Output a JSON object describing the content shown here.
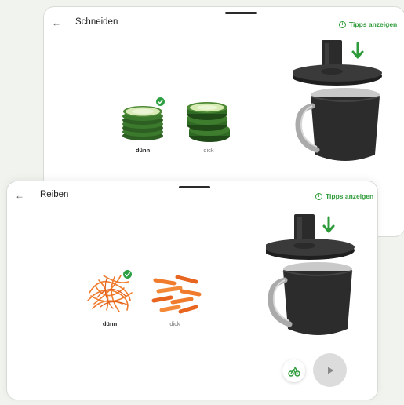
{
  "back_screen": {
    "title": "Schneiden",
    "tips_label": "Tipps anzeigen",
    "options": [
      {
        "label": "dünn",
        "selected": true
      },
      {
        "label": "dick",
        "selected": false
      }
    ]
  },
  "front_screen": {
    "title": "Reiben",
    "tips_label": "Tipps anzeigen",
    "options": [
      {
        "label": "dünn",
        "selected": true
      },
      {
        "label": "dick",
        "selected": false
      }
    ]
  },
  "icons": {
    "back": "←",
    "info": "i"
  },
  "colors": {
    "accent_green": "#2e9b3a",
    "cucumber": "#3f7a2f",
    "carrot": "#f07b2c",
    "device_body": "#2b2b2b"
  }
}
